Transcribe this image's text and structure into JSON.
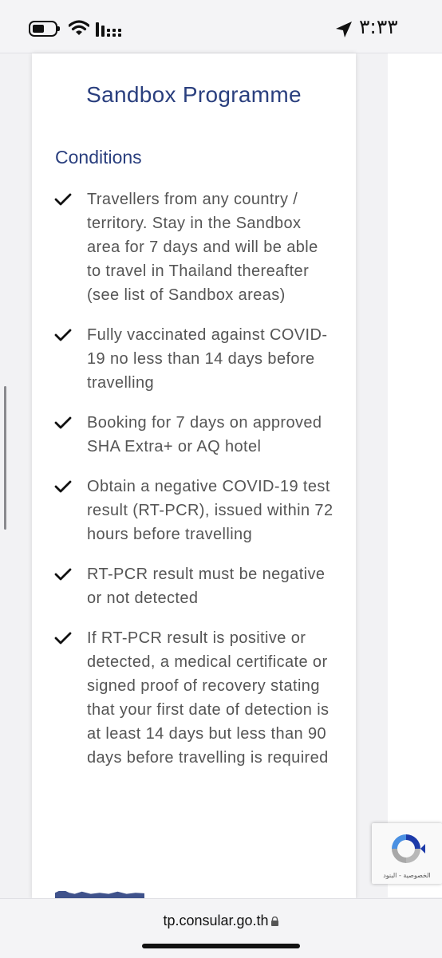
{
  "status_bar": {
    "time": "٣:٣٣",
    "icons": [
      "battery-icon",
      "wifi-icon",
      "cellular-signal-icon",
      "location-arrow-icon"
    ]
  },
  "page": {
    "title": "Sandbox Programme",
    "section_heading": "Conditions",
    "conditions": [
      "Travellers from any country / territory. Stay in the Sandbox area for 7 days and will be able to travel in Thailand thereafter (see list of Sandbox areas)",
      "Fully vaccinated against COVID-19 no less than 14 days before travelling",
      "Booking for 7 days on approved SHA Extra+ or AQ hotel",
      "Obtain a negative COVID-19 test result (RT-PCR), issued within 72 hours before travelling",
      "RT-PCR result must be negative or not detected",
      "If RT-PCR result is positive or detected, a medical certificate or signed proof of recovery stating that your first date of detection is at least 14 days but less than 90 days before travelling is required"
    ]
  },
  "recaptcha": {
    "links": "الخصوصية - البنود"
  },
  "url_bar": {
    "url": "tp.consular.go.th"
  },
  "colors": {
    "heading": "#2a3f7e",
    "body_text": "#555555",
    "check": "#111111"
  }
}
